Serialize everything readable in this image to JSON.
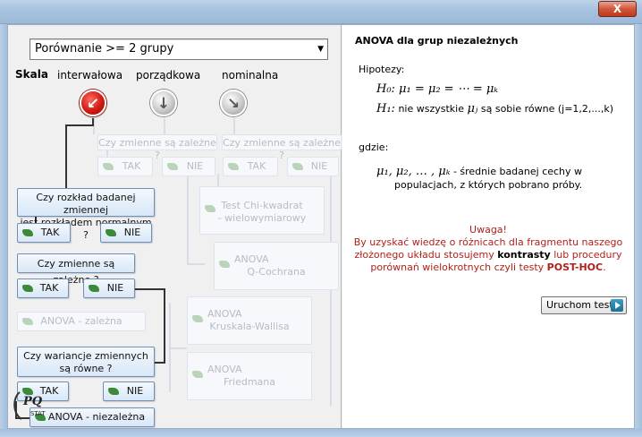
{
  "window": {
    "close_label": "X"
  },
  "dropdown": {
    "selected": "Porównanie >= 2 grupy",
    "arrow": "▼"
  },
  "scale": {
    "title": "Skala",
    "options": [
      "interwałowa",
      "porządkowa",
      "nominalna"
    ]
  },
  "tree": {
    "dependent_q1": "Czy zmienne są zależne ?",
    "dependent_q2": "Czy zmienne są zależne ?",
    "tak": "TAK",
    "nie": "NIE",
    "chi_line1": "Test Chi-kwadrat",
    "chi_line2": "- wielowymiarowy",
    "anova_q_line1": "ANOVA",
    "anova_q_line2": "Q-Cochrana",
    "normal_q_line1": "Czy rozkład badanej zmiennej",
    "normal_q_line2": "jest rozkładem normalnym ?",
    "kw_line1": "ANOVA",
    "kw_line2": "Kruskala-Wallisa",
    "dep_q3": "Czy zmienne są zależne ?",
    "anova_dep": "ANOVA - zależna",
    "fr_line1": "ANOVA",
    "fr_line2": "Friedmana",
    "var_q_line1": "Czy wariancje zmiennych",
    "var_q_line2": "są równe ?",
    "anova_indep": "ANOVA - niezależna"
  },
  "logo": {
    "text": "PQ STAT"
  },
  "right": {
    "title": "ANOVA dla grup niezależnych",
    "hipotezy": "Hipotezy:",
    "h0": "H₀: μ₁ = μ₂ = ⋯ = μₖ",
    "h1_sym": "H₁:",
    "h1_a": "nie wszystkie",
    "h1_mu": "μⱼ",
    "h1_b": "są sobie równe (j=1,2,...,k)",
    "gdzie": "gdzie:",
    "mus": "μ₁, μ₂, … , μₖ",
    "mus_desc1": "- średnie badanej cechy w",
    "mus_desc2": "populacjach, z których pobrano próby.",
    "uwaga": "Uwaga!",
    "warn1": "By uzyskać wiedzę o różnicach dla fragmentu naszego",
    "warn2_a": "złożonego układu stosujemy",
    "warn2_b": "kontrasty",
    "warn2_c": "lub procedury",
    "warn3_a": "porównań wielokrotnych czyli testy",
    "warn3_b": "POST-HOC",
    "warn3_c": ".",
    "run_label": "Uruchom test"
  }
}
